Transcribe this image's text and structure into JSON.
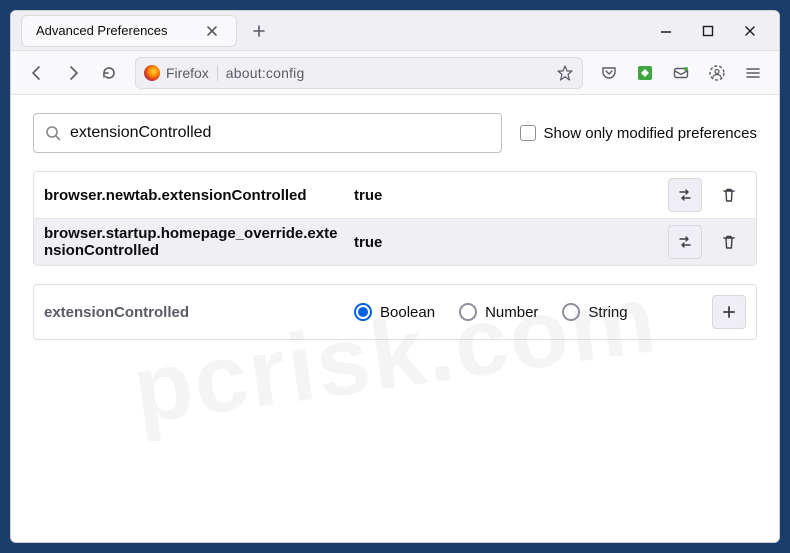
{
  "titlebar": {
    "tab_title": "Advanced Preferences"
  },
  "toolbar": {
    "identity_label": "Firefox",
    "url": "about:config"
  },
  "search": {
    "value": "extensionControlled",
    "checkbox_label": "Show only modified preferences"
  },
  "prefs": [
    {
      "name": "browser.newtab.extensionControlled",
      "value": "true"
    },
    {
      "name": "browser.startup.homepage_override.extensionControlled",
      "value": "true"
    }
  ],
  "new_pref": {
    "name": "extensionControlled",
    "types": [
      "Boolean",
      "Number",
      "String"
    ],
    "selected": 0
  },
  "watermark": "pcrisk.com"
}
